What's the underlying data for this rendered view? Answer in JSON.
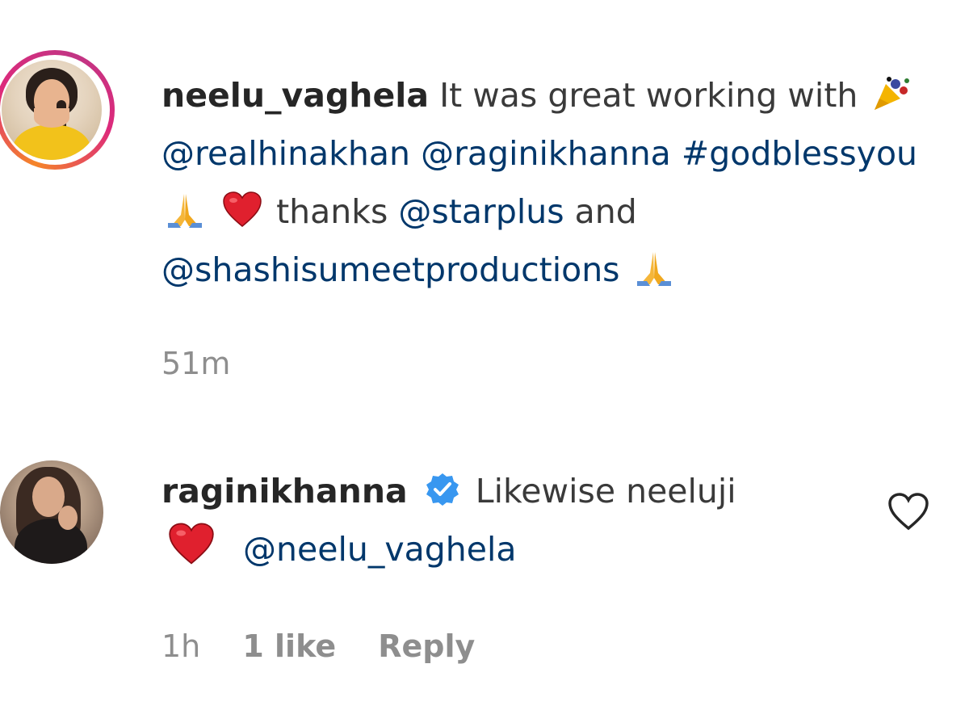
{
  "comments": [
    {
      "username": "neelu_vaghela",
      "text_part1": "It was great working with",
      "mention1": "@realhinakhan",
      "mention2": "@raginikhanna",
      "hashtag": "#godblessyou",
      "thanks": "thanks",
      "mention3": "@starplus",
      "and": "and",
      "mention4": "@shashisumeetproductions",
      "emojis": [
        "party-popper-icon",
        "folded-hands-icon",
        "red-heart-icon",
        "folded-hands-icon"
      ],
      "time": "51m",
      "has_story_ring": true
    },
    {
      "username": "raginikhanna",
      "verified": true,
      "text": "Likewise neeluji",
      "mention": "@neelu_vaghela",
      "emojis": [
        "red-heart-icon"
      ],
      "time": "1h",
      "likes": "1 like",
      "reply_label": "Reply"
    }
  ],
  "colors": {
    "link": "#00376b",
    "text": "#262626",
    "muted": "#8e8e8e",
    "verified": "#3897f0",
    "heart": "#e0202e"
  }
}
